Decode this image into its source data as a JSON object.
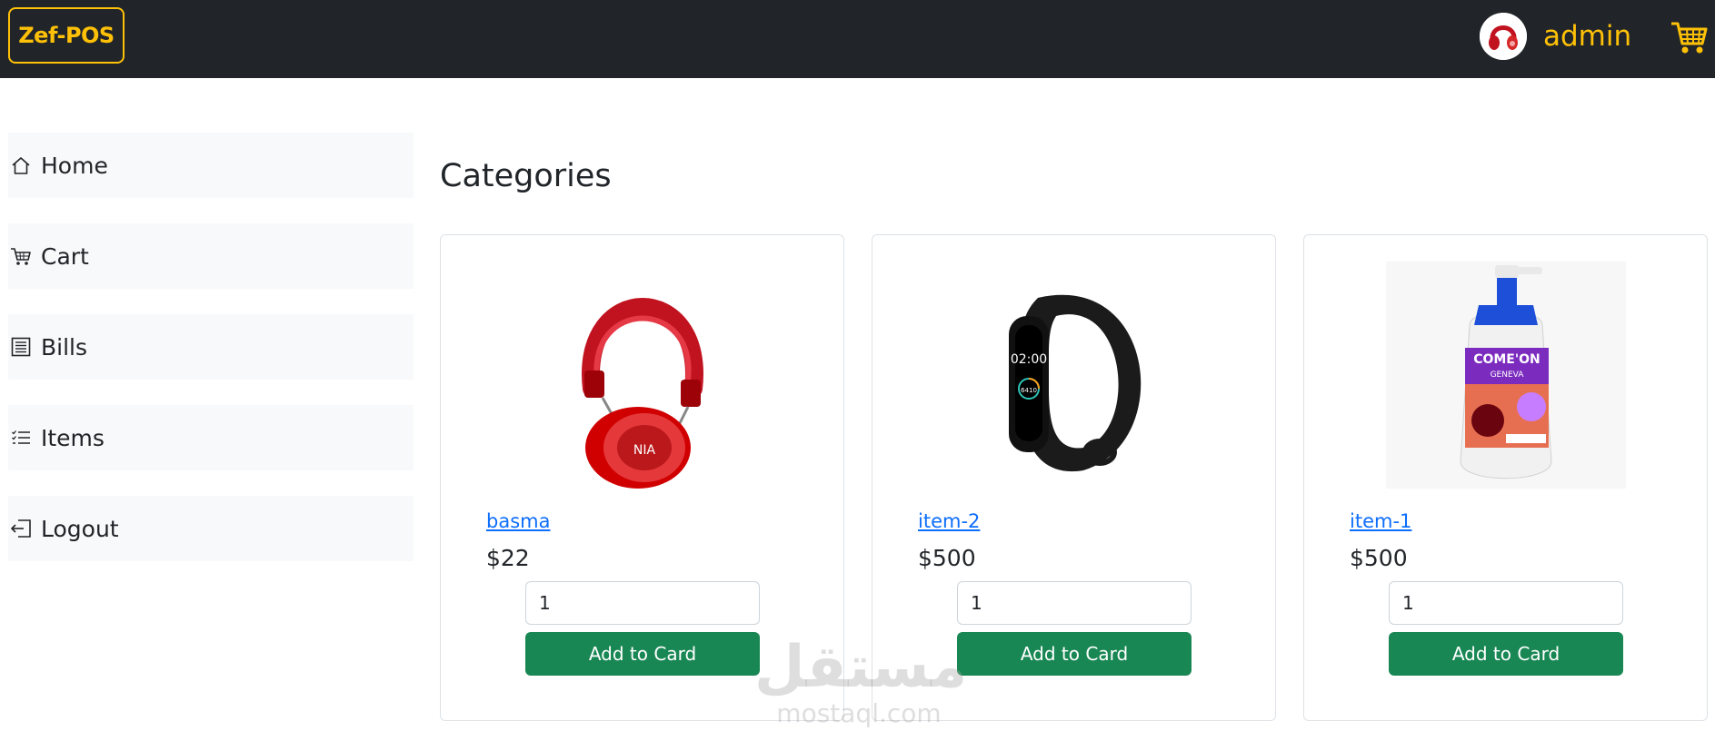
{
  "navbar": {
    "brand": "Zef-POS",
    "user": {
      "name": "admin",
      "avatar_icon": "headphones-avatar"
    },
    "cart_icon": "cart-icon"
  },
  "sidebar": {
    "items": [
      {
        "label": "Home",
        "icon": "house-icon"
      },
      {
        "label": "Cart",
        "icon": "cart-icon"
      },
      {
        "label": "Bills",
        "icon": "receipt-icon"
      },
      {
        "label": "Items",
        "icon": "list-icon"
      },
      {
        "label": "Logout",
        "icon": "logout-icon"
      }
    ]
  },
  "main": {
    "title": "Categories",
    "products": [
      {
        "name": "basma",
        "price": "$22",
        "quantity": "1",
        "button_label": "Add to Card",
        "image": "red-headphones"
      },
      {
        "name": "item-2",
        "price": "$500",
        "quantity": "1",
        "button_label": "Add to Card",
        "image": "black-fitness-band"
      },
      {
        "name": "item-1",
        "price": "$500",
        "quantity": "1",
        "button_label": "Add to Card",
        "image": "face-wash-bottle"
      }
    ]
  },
  "watermark": {
    "arabic": "مستقل",
    "latin": "mostaql.com"
  },
  "colors": {
    "navbar_bg": "#212529",
    "brand_accent": "#ffc107",
    "link": "#0d6efd",
    "button": "#198754",
    "sidebar_bg": "#f8f9fa"
  }
}
